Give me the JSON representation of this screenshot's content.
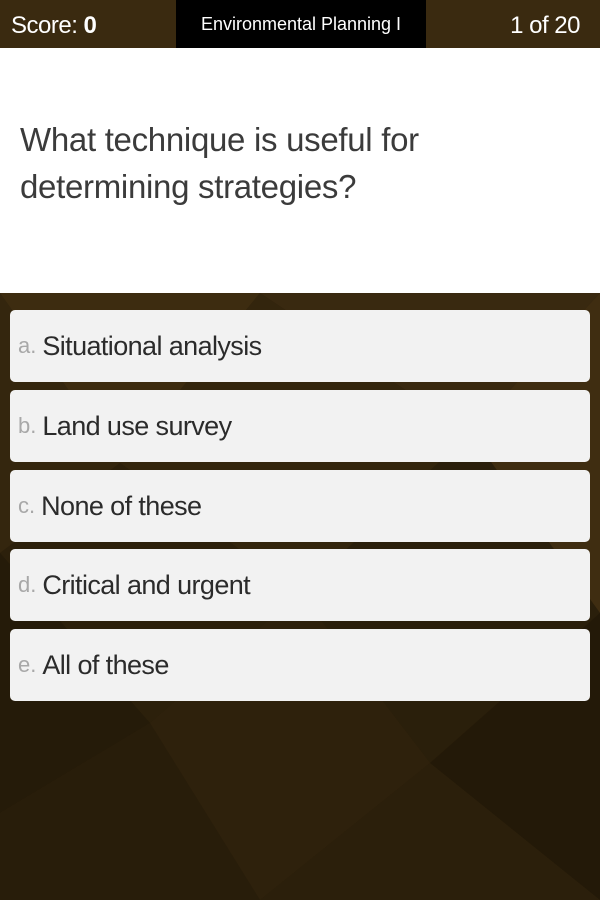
{
  "header": {
    "score_label": "Score:",
    "score_value": "0",
    "quiz_title": "Environmental Planning I",
    "progress": "1 of 20"
  },
  "question": {
    "text": "What technique is useful for determining strategies?"
  },
  "answers": [
    {
      "letter": "a.",
      "text": "Situational analysis"
    },
    {
      "letter": "b.",
      "text": "Land use survey"
    },
    {
      "letter": "c.",
      "text": "None of these"
    },
    {
      "letter": "d.",
      "text": "Critical and urgent"
    },
    {
      "letter": "e.",
      "text": "All of these"
    }
  ],
  "colors": {
    "header_bg": "#3a2a10",
    "title_bg": "#000000",
    "answer_bg": "#f2f2f2",
    "background": "#3a2a10"
  }
}
